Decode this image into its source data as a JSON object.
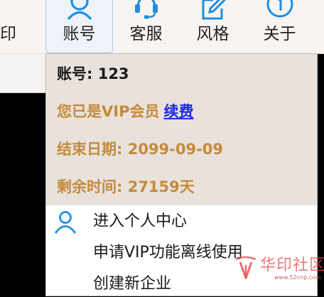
{
  "toolbar": {
    "print_label_partial": "印",
    "account_label": "账号",
    "service_label": "客服",
    "style_label": "风格",
    "about_label": "关于"
  },
  "icons": {
    "account": "user-icon",
    "service": "headset-icon",
    "style": "edit-icon",
    "about": "info-icon",
    "personal_center": "user-icon"
  },
  "account_info": {
    "account_line": "账号: 123",
    "vip_status": "您已是VIP会员",
    "renew_link": "续费",
    "end_date_line": "结束日期: 2099-09-09",
    "remaining_line": "剩余时间: 27159天"
  },
  "menu": {
    "items": [
      {
        "label": "进入个人中心"
      },
      {
        "label": "申请VIP功能离线使用"
      },
      {
        "label": "创建新企业"
      }
    ]
  },
  "watermark": {
    "text": "华印社区",
    "url": "www.52cnp.com"
  },
  "colors": {
    "accent_blue": "#1e8fe0",
    "vip_gold": "#c48a3c",
    "link_blue": "#1a29e8",
    "info_bg": "#e9e2dc"
  }
}
